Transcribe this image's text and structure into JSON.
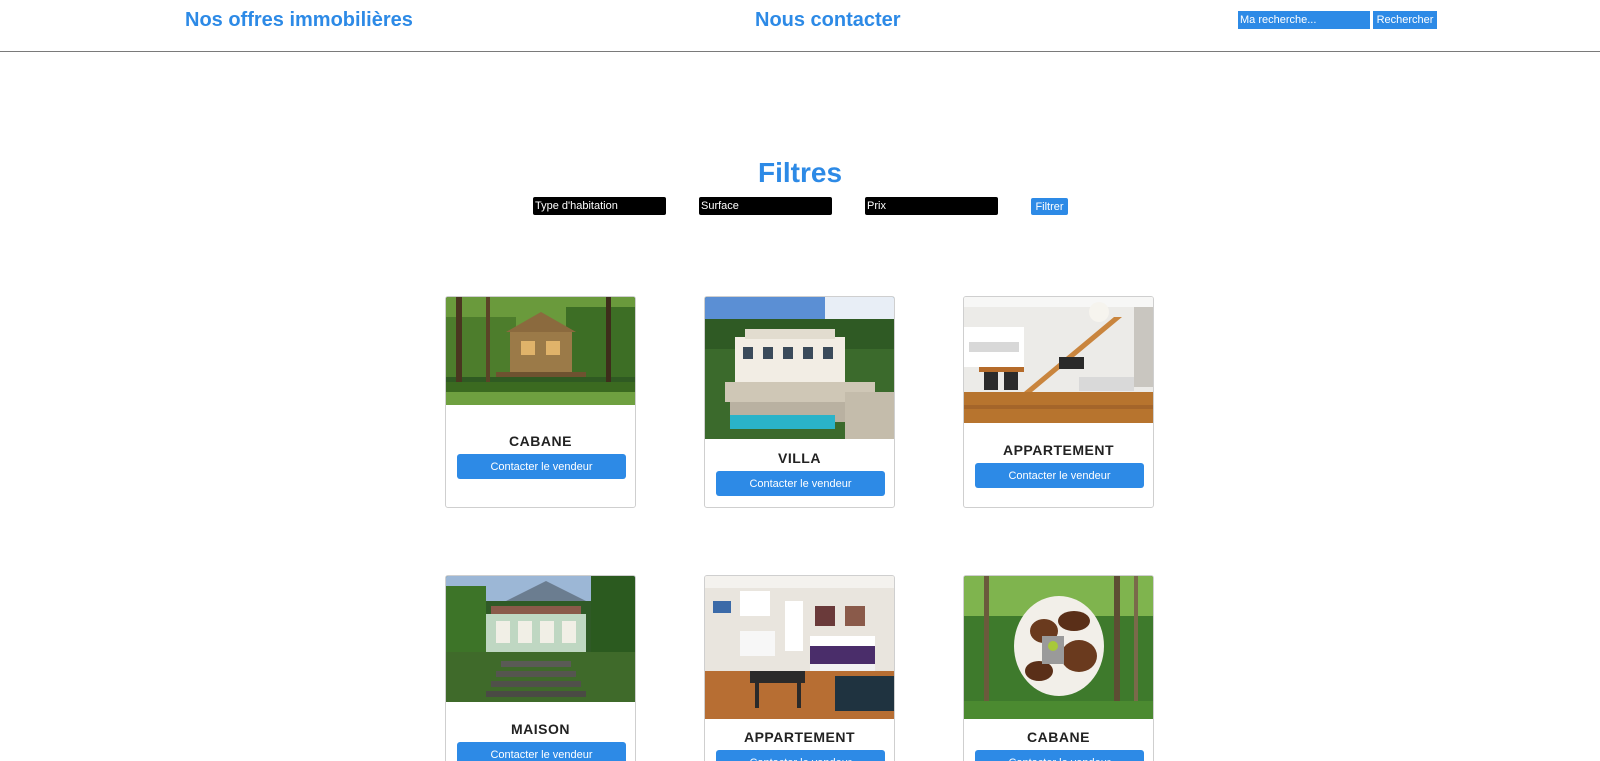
{
  "header": {
    "nav": {
      "offres": "Nos offres immobilières",
      "contact": "Nous contacter"
    },
    "search": {
      "placeholder": "Ma recherche...",
      "button_label": "Rechercher"
    }
  },
  "filters": {
    "title": "Filtres",
    "type_placeholder": "Type d'habitation",
    "surface_placeholder": "Surface",
    "prix_placeholder": "Prix",
    "button_label": "Filtrer"
  },
  "listings": [
    {
      "title": "CABANE",
      "button_label": "Contacter le vendeur",
      "image": "treehouse-photo"
    },
    {
      "title": "VILLA",
      "button_label": "Contacter le vendeur",
      "image": "villa-photo"
    },
    {
      "title": "APPARTEMENT",
      "button_label": "Contacter le vendeur",
      "image": "loft-apartment-photo"
    },
    {
      "title": "MAISON",
      "button_label": "Contacter le vendeur",
      "image": "tropical-house-photo"
    },
    {
      "title": "APPARTEMENT",
      "button_label": "Contacter le vendeur",
      "image": "studio-apartment-photo"
    },
    {
      "title": "CABANE",
      "button_label": "Contacter le vendeur",
      "image": "pod-cabin-photo"
    }
  ],
  "colors": {
    "accent": "#2d8ae6",
    "filter_field": "#000000",
    "card_border": "#cfcfcf"
  }
}
